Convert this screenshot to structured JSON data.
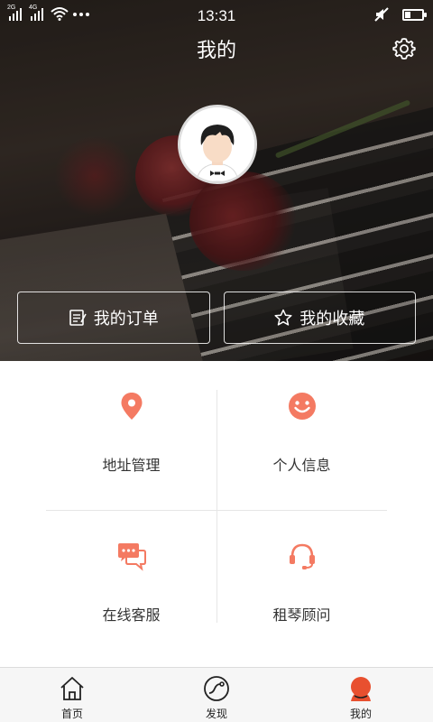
{
  "status_bar": {
    "network_1": "2G",
    "network_2": "4G",
    "time": "13:31",
    "battery_percent": 30,
    "icons": [
      "signal-icon",
      "signal-icon",
      "wifi-icon",
      "more-icon",
      "mute-icon",
      "battery-icon"
    ]
  },
  "header": {
    "title": "我的",
    "settings_icon": "gear-icon"
  },
  "profile": {
    "avatar_icon": "cartoon-avatar"
  },
  "actions": [
    {
      "label": "我的订单",
      "icon": "order-list-icon"
    },
    {
      "label": "我的收藏",
      "icon": "star-icon"
    }
  ],
  "menu": [
    {
      "label": "地址管理",
      "icon": "location-pin-icon"
    },
    {
      "label": "个人信息",
      "icon": "smiley-icon"
    },
    {
      "label": "在线客服",
      "icon": "chat-bubble-icon"
    },
    {
      "label": "租琴顾问",
      "icon": "headset-icon"
    }
  ],
  "bottom_nav": [
    {
      "label": "首页",
      "icon": "home-icon",
      "active": false
    },
    {
      "label": "发现",
      "icon": "discover-icon",
      "active": false
    },
    {
      "label": "我的",
      "icon": "profile-icon",
      "active": true
    }
  ],
  "colors": {
    "accent": "#f47a62",
    "text": "#333333",
    "divider": "#e6e6e6",
    "nav_bg": "#f6f6f6"
  }
}
